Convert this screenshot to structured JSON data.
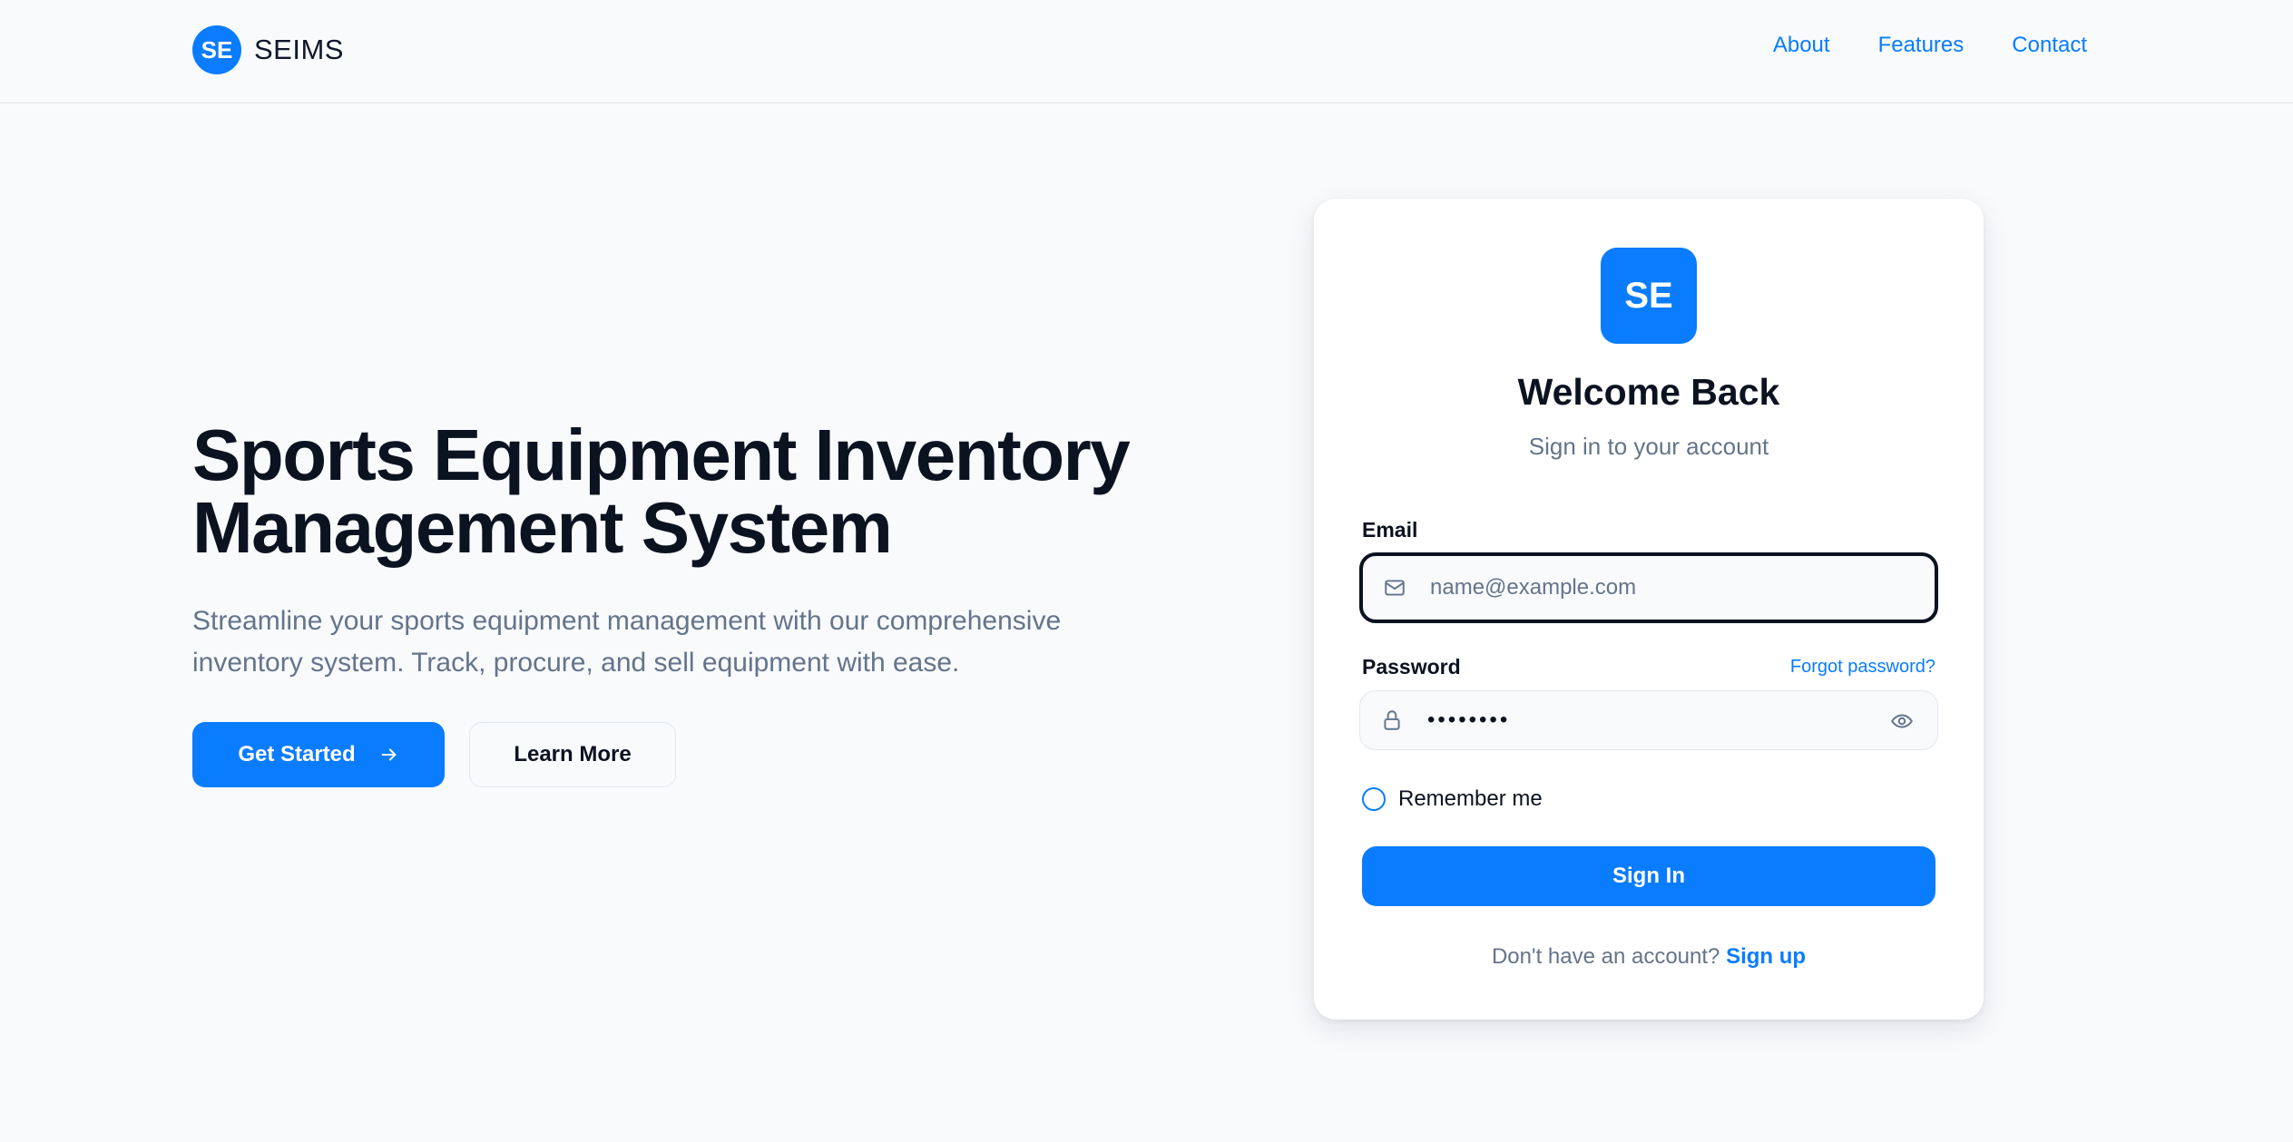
{
  "brand": {
    "logo": "SE",
    "name": "SEIMS"
  },
  "nav": {
    "items": [
      {
        "label": "About"
      },
      {
        "label": "Features"
      },
      {
        "label": "Contact"
      }
    ]
  },
  "hero": {
    "title_line1": "Sports Equipment Inventory",
    "title_line2": "Management System",
    "description": "Streamline your sports equipment management with our comprehensive inventory system. Track, procure, and sell equipment with ease.",
    "primary_cta": "Get Started",
    "secondary_cta": "Learn More"
  },
  "login": {
    "logo": "SE",
    "title": "Welcome Back",
    "subtitle": "Sign in to your account",
    "email_label": "Email",
    "email_placeholder": "name@example.com",
    "password_label": "Password",
    "forgot": "Forgot password?",
    "password_value": "••••••••",
    "remember": "Remember me",
    "remember_checked": false,
    "submit": "Sign In",
    "no_account": "Don't have an account?",
    "signup": "Sign up"
  },
  "icons": {
    "email": "mail-icon",
    "password": "lock-icon",
    "toggle": "eye-icon",
    "cta": "arrow-right-icon"
  },
  "colors": {
    "accent": "#0a7cff",
    "background": "#f8fafc",
    "text": "#0b1220",
    "muted": "#64748b"
  }
}
